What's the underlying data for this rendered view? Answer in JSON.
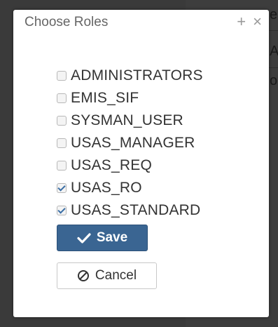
{
  "dialog": {
    "title": "Choose Roles",
    "actions": {
      "add_glyph": "+",
      "close_glyph": "×"
    }
  },
  "roles": [
    {
      "label": "ADMINISTRATORS",
      "checked": false
    },
    {
      "label": "EMIS_SIF",
      "checked": false
    },
    {
      "label": "SYSMAN_USER",
      "checked": false
    },
    {
      "label": "USAS_MANAGER",
      "checked": false
    },
    {
      "label": "USAS_REQ",
      "checked": false
    },
    {
      "label": "USAS_RO",
      "checked": true
    },
    {
      "label": "USAS_STANDARD",
      "checked": true
    }
  ],
  "buttons": {
    "save_label": "Save",
    "save_icon": "check-icon",
    "cancel_label": "Cancel",
    "cancel_icon": "ban-icon"
  },
  "background": {
    "peek_chars": [
      "e",
      "A",
      "o"
    ]
  },
  "colors": {
    "primary": "#3a6592",
    "checkmark": "#3a6ea5",
    "title_text": "#666666",
    "overlay": "#3a3a3a"
  }
}
